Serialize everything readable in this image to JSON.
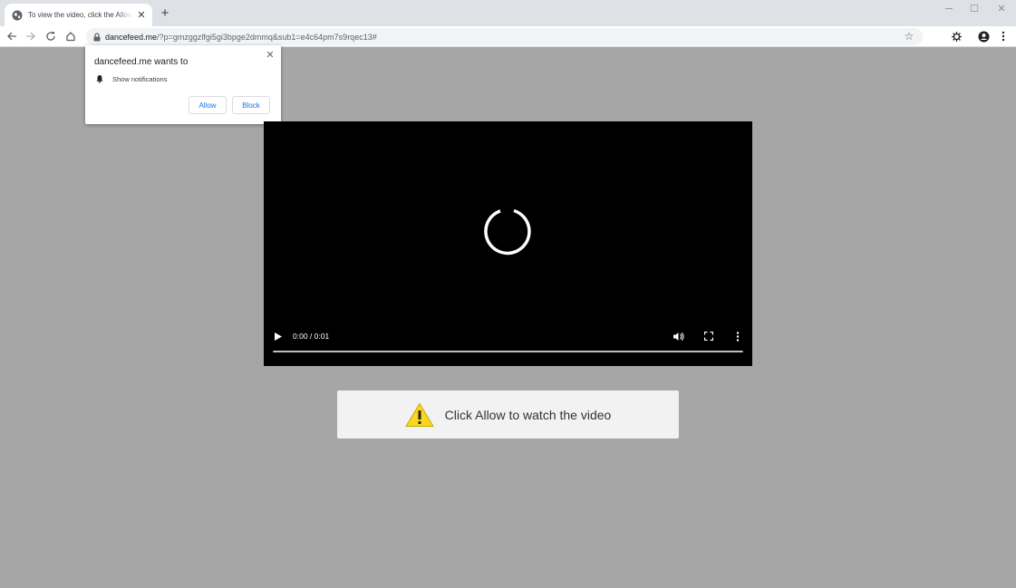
{
  "tab": {
    "title": "To view the video, click the Allow button",
    "favicon": "globe-icon",
    "close": "✕"
  },
  "new_tab": "+",
  "window_controls": {
    "minimize": "─",
    "maximize": "☐",
    "close": "✕"
  },
  "address_bar": {
    "host": "dancefeed.me",
    "path": "/?p=gmzggzlfgi5gi3bpge2dmmq&sub1=e4c64pm7s9rqec13#"
  },
  "popup": {
    "title": "dancefeed.me wants to",
    "permission": "Show notifications",
    "allow": "Allow",
    "block": "Block",
    "close": "✕"
  },
  "video": {
    "time": "0:00 / 0:01",
    "progress": 0
  },
  "banner": {
    "text": "Click Allow to watch the video"
  },
  "colors": {
    "page_background": "#a6a6a6",
    "link_blue": "#1a73e8",
    "warning_yellow": "#f9d71c"
  }
}
